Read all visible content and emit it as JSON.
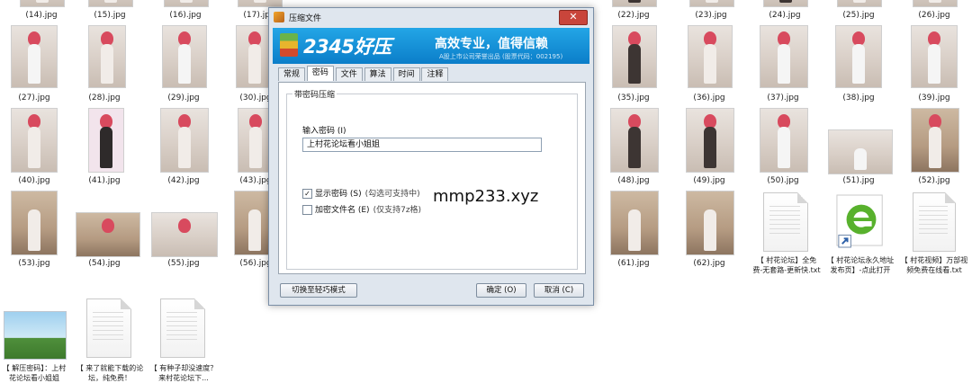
{
  "files_row0": [
    "(14).jpg",
    "(15).jpg",
    "(16).jpg",
    "(17).jpg",
    "(22).jpg",
    "(23).jpg",
    "(24).jpg",
    "(25).jpg",
    "(26).jpg"
  ],
  "files_row1": [
    "(27).jpg",
    "(28).jpg",
    "(29).jpg",
    "(30).jpg",
    "(35).jpg",
    "(36).jpg",
    "(37).jpg",
    "(38).jpg",
    "(39).jpg"
  ],
  "files_row2": [
    "(40).jpg",
    "(41).jpg",
    "(42).jpg",
    "(43).jpg",
    "(48).jpg",
    "(49).jpg",
    "(50).jpg",
    "(51).jpg",
    "(52).jpg"
  ],
  "files_row3": [
    "(53).jpg",
    "(54).jpg",
    "(55).jpg",
    "(56).jpg",
    "(61).jpg",
    "(62).jpg"
  ],
  "doc_files": [
    "【 村花论坛】全免费-无套路-更新快.txt",
    "【 村花论坛永久地址发布页】-点此打开",
    "【 村花视频】万部视频免费在线看.txt"
  ],
  "bottom_files": [
    "【 解压密码】：上村花论坛看小姐姐",
    "【 来了就能下载的论坛，纯免费！",
    "【 有种子却没速度？来村花论坛下..."
  ],
  "dialog": {
    "title": "压缩文件",
    "close": "✕",
    "brand": "2345好压",
    "slogan": "高效专业，值得信赖",
    "sub": "A股上市公司荣誉出品 (股票代码：002195)",
    "tabs": [
      "常规",
      "密码",
      "文件",
      "算法",
      "时间",
      "注释"
    ],
    "group_title": "带密码压缩",
    "password_label": "输入密码 (I)",
    "password_value": "上村花论坛看小姐姐",
    "show_pw_label": "显示密码 (S)",
    "show_pw_hint": "(勾选可支持中)",
    "encrypt_names_label": "加密文件名 (E)",
    "encrypt_names_hint": "(仅支持7z格)",
    "mode_button": "切换至轻巧模式",
    "ok_button": "确定 (O)",
    "cancel_button": "取消 (C)"
  },
  "watermark": "mmp233.xyz"
}
